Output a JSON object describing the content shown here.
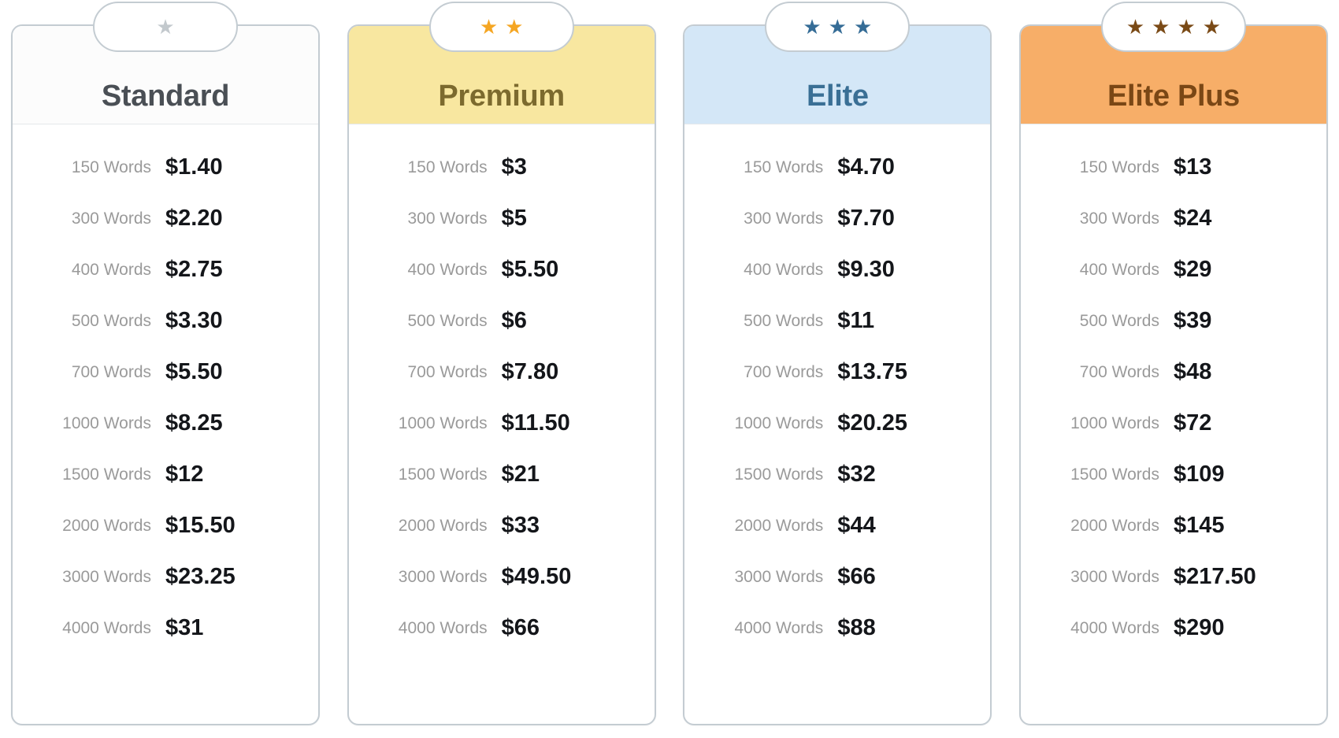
{
  "plans": [
    {
      "name": "Standard",
      "stars": 1,
      "star_color": "#c3c9cd",
      "header_bg": "#fcfcfc",
      "title_color": "#4a4f55",
      "rows": [
        {
          "label": "150 Words",
          "price": "$1.40"
        },
        {
          "label": "300 Words",
          "price": "$2.20"
        },
        {
          "label": "400 Words",
          "price": "$2.75"
        },
        {
          "label": "500 Words",
          "price": "$3.30"
        },
        {
          "label": "700 Words",
          "price": "$5.50"
        },
        {
          "label": "1000 Words",
          "price": "$8.25"
        },
        {
          "label": "1500 Words",
          "price": "$12"
        },
        {
          "label": "2000 Words",
          "price": "$15.50"
        },
        {
          "label": "3000 Words",
          "price": "$23.25"
        },
        {
          "label": "4000 Words",
          "price": "$31"
        }
      ]
    },
    {
      "name": "Premium",
      "stars": 2,
      "star_color": "#f5a623",
      "header_bg": "#f8e7a0",
      "title_color": "#7c6a2e",
      "rows": [
        {
          "label": "150 Words",
          "price": "$3"
        },
        {
          "label": "300 Words",
          "price": "$5"
        },
        {
          "label": "400 Words",
          "price": "$5.50"
        },
        {
          "label": "500 Words",
          "price": "$6"
        },
        {
          "label": "700 Words",
          "price": "$7.80"
        },
        {
          "label": "1000 Words",
          "price": "$11.50"
        },
        {
          "label": "1500 Words",
          "price": "$21"
        },
        {
          "label": "2000 Words",
          "price": "$33"
        },
        {
          "label": "3000 Words",
          "price": "$49.50"
        },
        {
          "label": "4000 Words",
          "price": "$66"
        }
      ]
    },
    {
      "name": "Elite",
      "stars": 3,
      "star_color": "#356c96",
      "header_bg": "#d4e7f7",
      "title_color": "#3a6f95",
      "rows": [
        {
          "label": "150 Words",
          "price": "$4.70"
        },
        {
          "label": "300 Words",
          "price": "$7.70"
        },
        {
          "label": "400 Words",
          "price": "$9.30"
        },
        {
          "label": "500 Words",
          "price": "$11"
        },
        {
          "label": "700 Words",
          "price": "$13.75"
        },
        {
          "label": "1000 Words",
          "price": "$20.25"
        },
        {
          "label": "1500 Words",
          "price": "$32"
        },
        {
          "label": "2000 Words",
          "price": "$44"
        },
        {
          "label": "3000 Words",
          "price": "$66"
        },
        {
          "label": "4000 Words",
          "price": "$88"
        }
      ]
    },
    {
      "name": "Elite Plus",
      "stars": 4,
      "star_color": "#7a4a16",
      "header_bg": "#f7ae68",
      "title_color": "#7a4715",
      "rows": [
        {
          "label": "150 Words",
          "price": "$13"
        },
        {
          "label": "300 Words",
          "price": "$24"
        },
        {
          "label": "400 Words",
          "price": "$29"
        },
        {
          "label": "500 Words",
          "price": "$39"
        },
        {
          "label": "700 Words",
          "price": "$48"
        },
        {
          "label": "1000 Words",
          "price": "$72"
        },
        {
          "label": "1500 Words",
          "price": "$109"
        },
        {
          "label": "2000 Words",
          "price": "$145"
        },
        {
          "label": "3000 Words",
          "price": "$217.50"
        },
        {
          "label": "4000 Words",
          "price": "$290"
        }
      ]
    }
  ]
}
